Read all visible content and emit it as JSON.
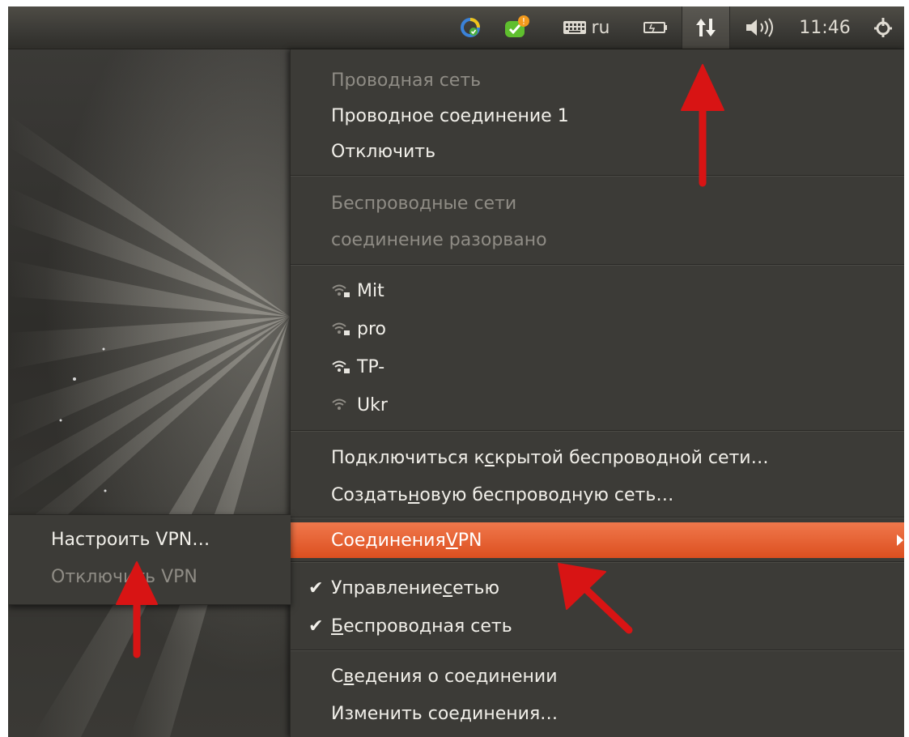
{
  "panel": {
    "keyboard_layout": "ru",
    "clock": "11:46",
    "pidgin_badge": "!"
  },
  "menu": {
    "wired_header": "Проводная сеть",
    "wired_connection": "Проводное соединение 1",
    "disconnect": "Отключить",
    "wireless_header": "Беспроводные сети",
    "wireless_status": "соединение разорвано",
    "networks": [
      {
        "name": "Mit"
      },
      {
        "name": "pro"
      },
      {
        "name": "TP-"
      },
      {
        "name": "Ukr"
      }
    ],
    "hidden_pre": "Подключиться к ",
    "hidden_u": "с",
    "hidden_post": "крытой беспроводной сети…",
    "create_pre": "Создать ",
    "create_u": "н",
    "create_post": "овую беспроводную сеть…",
    "vpn_pre": "Соединения ",
    "vpn_u": "V",
    "vpn_post": "PN",
    "manage_pre": "Управление ",
    "manage_u": "с",
    "manage_post": "етью",
    "wireless_u": "Б",
    "wireless_post": "еспроводная сеть",
    "info_pre": "С",
    "info_u": "в",
    "info_post": "едения о соединении",
    "edit": "Изменить соединения…"
  },
  "vpn_submenu": {
    "configure": "Настроить VPN…",
    "disconnect": "Отключить VPN"
  },
  "colors": {
    "highlight": "#e95420",
    "annotation_arrow": "#d81414"
  },
  "icons": [
    "status-ring-icon",
    "pidgin-icon",
    "keyboard-icon",
    "battery-icon",
    "network-updown-icon",
    "volume-icon",
    "power-gear-icon",
    "wifi-locked-icon",
    "wifi-icon",
    "checkmark-icon",
    "submenu-arrow-icon"
  ]
}
